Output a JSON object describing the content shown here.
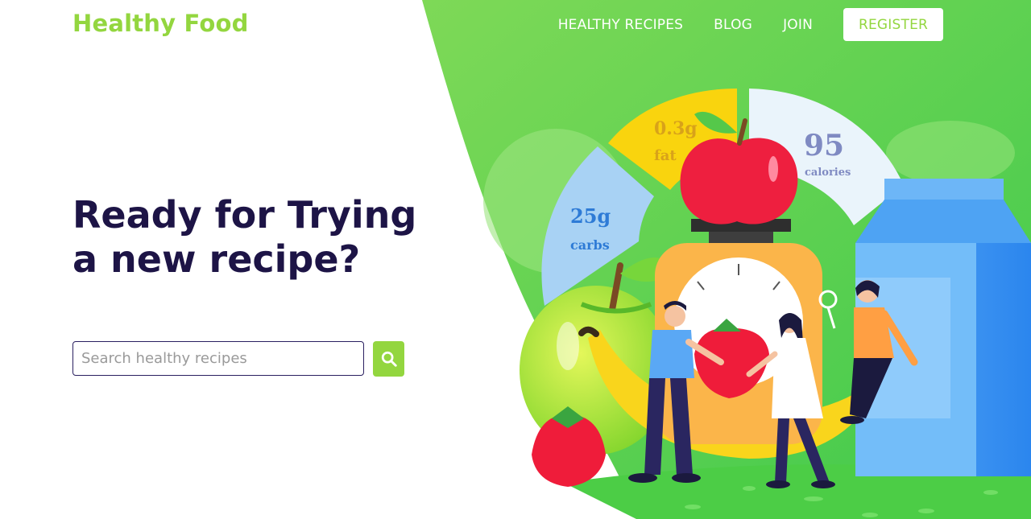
{
  "brand": {
    "name": "Healthy Food"
  },
  "nav": {
    "items": [
      {
        "label": "HEALTHY RECIPES"
      },
      {
        "label": "BLOG"
      },
      {
        "label": "JOIN"
      }
    ],
    "register_label": "REGISTER"
  },
  "hero": {
    "headline": "Ready for Trying a new recipe?",
    "search": {
      "placeholder": "Search healthy recipes",
      "value": ""
    }
  },
  "nutrition": {
    "fat": {
      "value": "0.3g",
      "label": "fat"
    },
    "carbs": {
      "value": "25g",
      "label": "carbs"
    },
    "calories": {
      "value": "95",
      "label": "calories"
    }
  },
  "colors": {
    "brand_green": "#93d63f",
    "headline_navy": "#1d1446",
    "hero_green": "#5cd35a"
  },
  "icons": [
    "search-icon"
  ]
}
